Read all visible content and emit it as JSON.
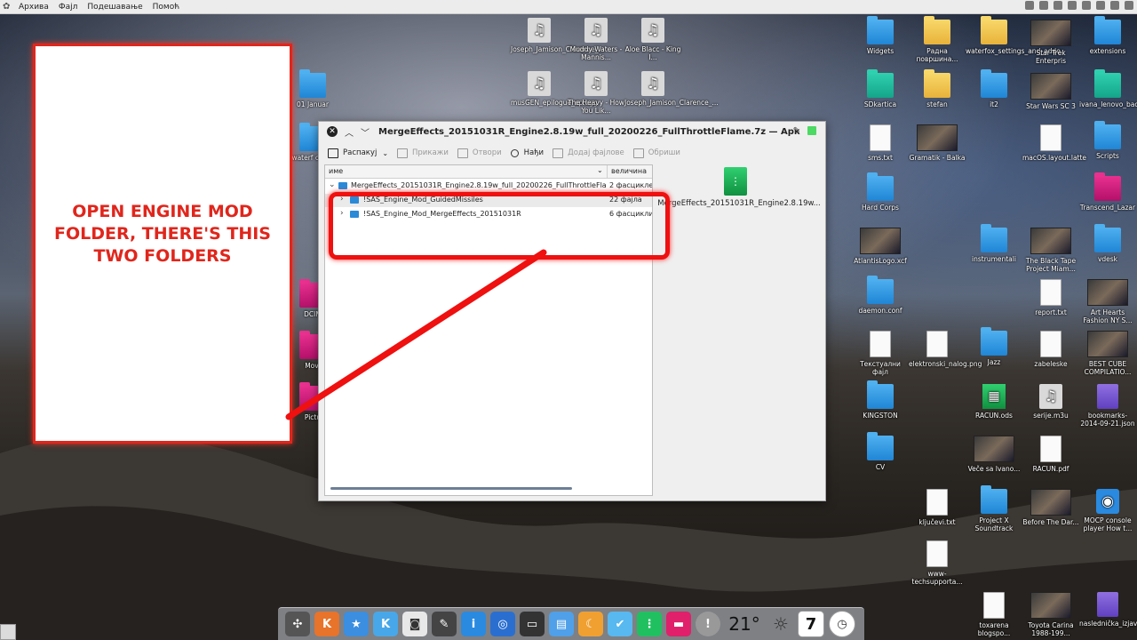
{
  "menubar": {
    "items": [
      "Архива",
      "Фајл",
      "Подешавање",
      "Помоћ"
    ]
  },
  "desktop": {
    "icons_center": [
      {
        "label": "Joseph_Jamison_Clarence_...",
        "kind": "audio"
      },
      {
        "label": "Muddy Waters - Mannis...",
        "kind": "audio"
      },
      {
        "label": "Aloe Blacc - King I...",
        "kind": "audio"
      },
      {
        "label": "musGEN_epilogue_ep.ogg",
        "kind": "audio"
      },
      {
        "label": "The Heavy - How You Lik...",
        "kind": "audio"
      },
      {
        "label": "Joseph_Jamison_Clarence_...",
        "kind": "audio"
      }
    ],
    "icons_left": [
      {
        "label": "01 Januar"
      },
      {
        "label": "waterf classi"
      },
      {
        "label": "DCIM"
      },
      {
        "label": "Movi"
      },
      {
        "label": "Pictu"
      }
    ],
    "icons_right": [
      {
        "label": "Widgets"
      },
      {
        "label": "Радна површина..."
      },
      {
        "label": "waterfox_settings_and_addo"
      },
      {
        "label": "Star Trek Enterpris"
      },
      {
        "label": "extensions"
      },
      {
        "label": "SDkartica"
      },
      {
        "label": "stefan"
      },
      {
        "label": "it2"
      },
      {
        "label": "Star Wars SC 3"
      },
      {
        "label": "ivana_lenovo_backup"
      },
      {
        "label": "sms.txt"
      },
      {
        "label": "Gramatik - Balka"
      },
      {
        "label": "macOS.layout.latte"
      },
      {
        "label": "Scripts"
      },
      {
        "label": "Hard Corps"
      },
      {
        "label": "Transcend_Lazar"
      },
      {
        "label": "AtlantisLogo.xcf"
      },
      {
        "label": "instrumentali"
      },
      {
        "label": "The Black Tape Project Miam..."
      },
      {
        "label": "vdesk"
      },
      {
        "label": "daemon.conf"
      },
      {
        "label": "report.txt"
      },
      {
        "label": "Art Hearts Fashion NY S..."
      },
      {
        "label": "Текстуални фајл"
      },
      {
        "label": "elektronski_nalog.png"
      },
      {
        "label": "Jazz"
      },
      {
        "label": "zabeleske"
      },
      {
        "label": "BEST CUBE COMPILATIO..."
      },
      {
        "label": "KINGSTON"
      },
      {
        "label": "RACUN.ods"
      },
      {
        "label": "serije.m3u"
      },
      {
        "label": "bookmarks-2014-09-21.json"
      },
      {
        "label": "CV"
      },
      {
        "label": "Veče sa Ivano..."
      },
      {
        "label": "RACUN.pdf"
      },
      {
        "label": "ključevi.txt"
      },
      {
        "label": "Project X Soundtrack"
      },
      {
        "label": "Before The Dar..."
      },
      {
        "label": "MOCP console player How t..."
      },
      {
        "label": "www-techsupporta..."
      },
      {
        "label": "toxarena blogspo..."
      },
      {
        "label": "Toyota Carina 1988-199..."
      },
      {
        "label": "naslednička_izjava.doc"
      }
    ]
  },
  "annotation": {
    "text": "OPEN ENGINE MOD FOLDER, THERE'S THIS TWO FOLDERS"
  },
  "window": {
    "title": "MergeEffects_20151031R_Engine2.8.19w_full_20200226_FullThrottleFlame.7z — Арк",
    "toolbar": {
      "extract": "Распакуј",
      "preview": "Прикажи",
      "open": "Отвори",
      "find": "Нађи",
      "add_files": "Додај фајлове",
      "delete": "Обриши"
    },
    "columns": {
      "name": "име",
      "size": "величина"
    },
    "rows": [
      {
        "name": "MergeEffects_20151031R_Engine2.8.19w_full_20200226_FullThrottleFlame",
        "size": "2 фасцикле",
        "level": 0,
        "expanded": true
      },
      {
        "name": "!SAS_Engine_Mod_GuidedMissiles",
        "size": "22 фајла",
        "level": 1,
        "expanded": false
      },
      {
        "name": "!SAS_Engine_Mod_MergeEffects_20151031R",
        "size": "6 фасцикли,",
        "level": 1,
        "expanded": false
      }
    ],
    "preview_name": "MergeEffects_20151031R_Engine2.8.19w..."
  },
  "dock": {
    "temperature": "21°",
    "calendar_day": "7"
  },
  "colors": {
    "annotation_red": "#e0261c",
    "highlight_red": "#ef1010",
    "folder_blue": "#2a8ad8"
  }
}
